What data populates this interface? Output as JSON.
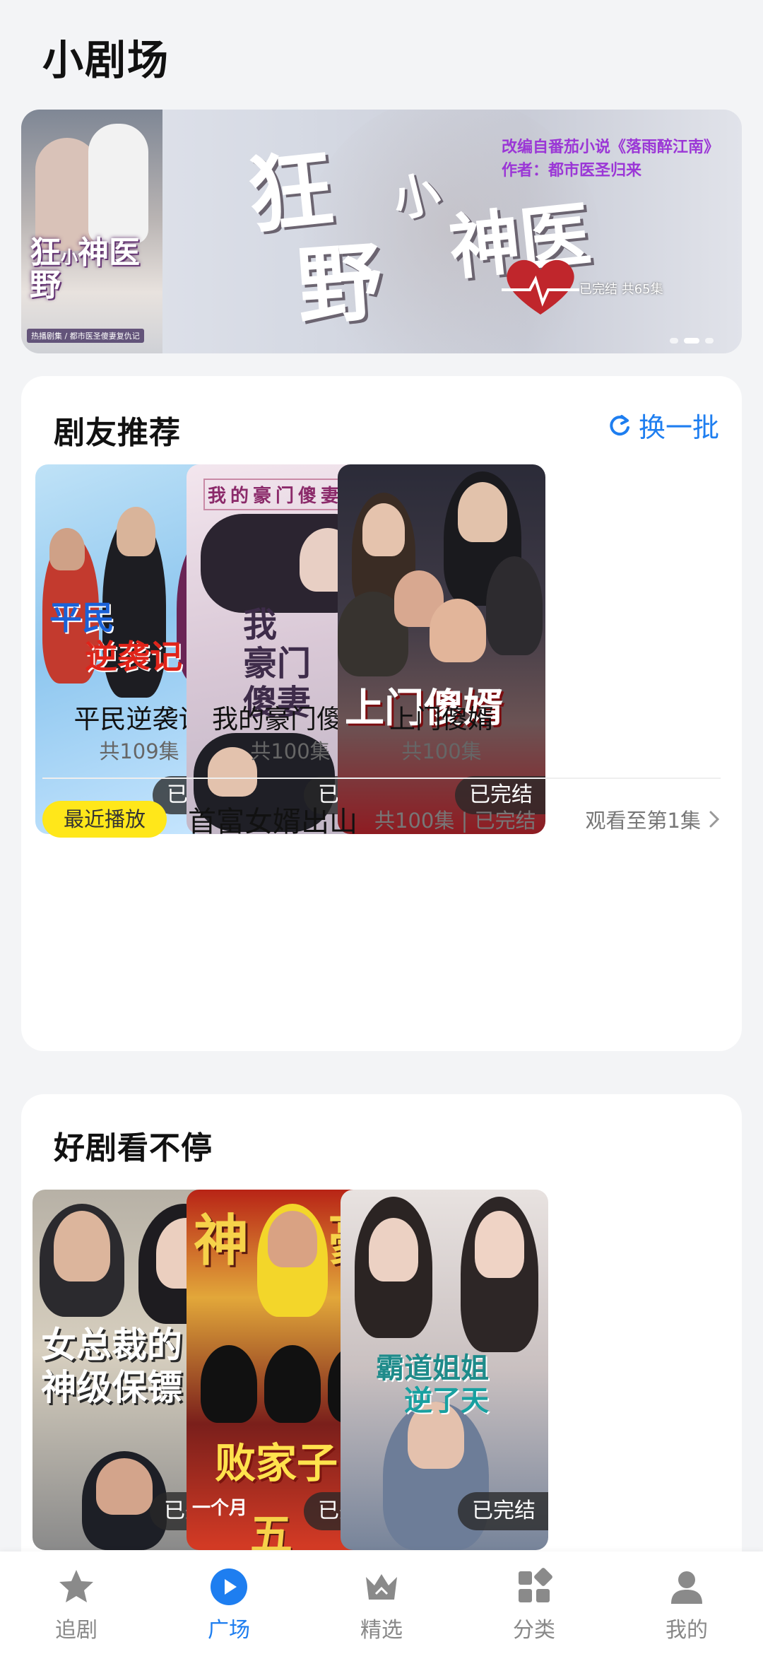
{
  "page": {
    "title": "小剧场"
  },
  "banner": {
    "poster_title": "狂 小神医 野",
    "poster_sub": "热播剧集 / 都市医圣傻妻复仇记",
    "title_chars": [
      "狂",
      "野",
      "小",
      "神医"
    ],
    "credit_line1": "改编自番茄小说《落雨醉江南》",
    "credit_line2": "作者：都市医圣归来",
    "status": "已完结 共65集"
  },
  "recommend": {
    "title": "剧友推荐",
    "refresh_label": "换一批",
    "items": [
      {
        "name": "平民逆袭记",
        "episodes": "共109集",
        "badge": "已完结",
        "cover_text": "平民\n逆袭记"
      },
      {
        "name": "我的豪门傻妻",
        "episodes": "共100集",
        "badge": "已完结",
        "cover_text": "我的豪门傻妻"
      },
      {
        "name": "上门傻婿",
        "episodes": "共100集",
        "badge": "已完结",
        "cover_text": "上门傻婿"
      }
    ],
    "recent": {
      "tag": "最近播放",
      "title": "首富女婿出山",
      "meta": "共100集 | 已完结",
      "progress": "观看至第1集"
    }
  },
  "good": {
    "title": "好剧看不停",
    "items": [
      {
        "badge": "已完结",
        "cover_text": "女总裁的\n神级保镖"
      },
      {
        "badge": "已完结",
        "cover_text": "神 豪 败家子"
      },
      {
        "badge": "已完结",
        "cover_text": "霸道姐姐\n逆了天"
      }
    ]
  },
  "nav": {
    "items": [
      {
        "label": "追剧",
        "icon": "star-icon"
      },
      {
        "label": "广场",
        "icon": "play-icon",
        "active": true
      },
      {
        "label": "精选",
        "icon": "crown-icon"
      },
      {
        "label": "分类",
        "icon": "grid-icon"
      },
      {
        "label": "我的",
        "icon": "user-icon"
      }
    ]
  },
  "colors": {
    "accent": "#1e7ef0",
    "tag": "#ffe71a"
  }
}
